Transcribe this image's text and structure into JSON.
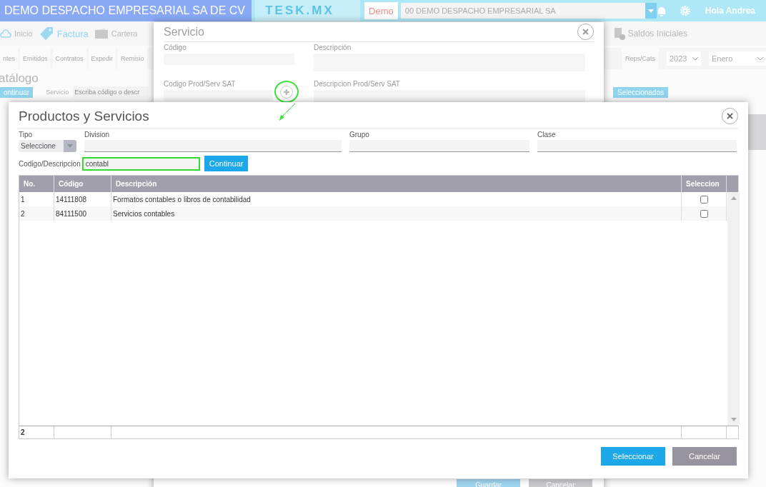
{
  "app_header": {
    "company": "DEMO DESPACHO EMPRESARIAL SA DE CV",
    "brand": "TESK.MX",
    "badge": "Demo",
    "company_select": "00 DEMO DESPACHO EMPRESARIAL SA",
    "greeting": "Hola Andrea"
  },
  "main_nav": [
    {
      "label": "Inicio",
      "kind": "cloud",
      "selected": false
    },
    {
      "label": "Factura",
      "kind": "tag",
      "selected": true
    },
    {
      "label": "Cartera",
      "kind": "wallet",
      "selected": false
    }
  ],
  "nav_right": {
    "label": "Saldos Iniciales"
  },
  "sub_nav": [
    "ntes",
    "Emitidos",
    "Contratos",
    "Expedir",
    "Remisio"
  ],
  "sub_nav_right": "Reps/Cats",
  "period": {
    "year": "2023",
    "month": "Enero"
  },
  "page_title": "atálogo",
  "toolbar": {
    "button": "ontinuar",
    "label": "Servicio",
    "placeholder": "Escriba código o descr",
    "right_button": "Seleccionados"
  },
  "service_dialog": {
    "title": "Servicio",
    "fields": [
      {
        "label": "Código"
      },
      {
        "label": "Descripción"
      },
      {
        "label": "Codigo Prod/Serv SAT"
      },
      {
        "label": "Descripcion Prod/Serv SAT"
      }
    ],
    "buttons": [
      "Guardar",
      "Cancelar"
    ]
  },
  "products_dialog": {
    "title": "Productos y Servicios",
    "tipo": {
      "label": "Tipo",
      "value": "Seleccione"
    },
    "filters": [
      {
        "label": "Division"
      },
      {
        "label": "Grupo"
      },
      {
        "label": "Clase"
      }
    ],
    "search": {
      "label": "Codigo/Descripcion",
      "value": "contabl"
    },
    "search_button": "Continuar",
    "table": {
      "columns": [
        "No.",
        "Código",
        "Descripción",
        "Seleccion"
      ],
      "rows": [
        {
          "no": "1",
          "code": "14111808",
          "description": "Formatos contables o libros de contabilidad",
          "checked": false
        },
        {
          "no": "2",
          "code": "84111500",
          "description": "Servicios contables",
          "checked": false
        }
      ],
      "footer": {
        "count": "2"
      }
    },
    "buttons": [
      {
        "label": "Seleccionar",
        "kind": "primary"
      },
      {
        "label": "Cancelar",
        "kind": "secondary"
      }
    ]
  }
}
